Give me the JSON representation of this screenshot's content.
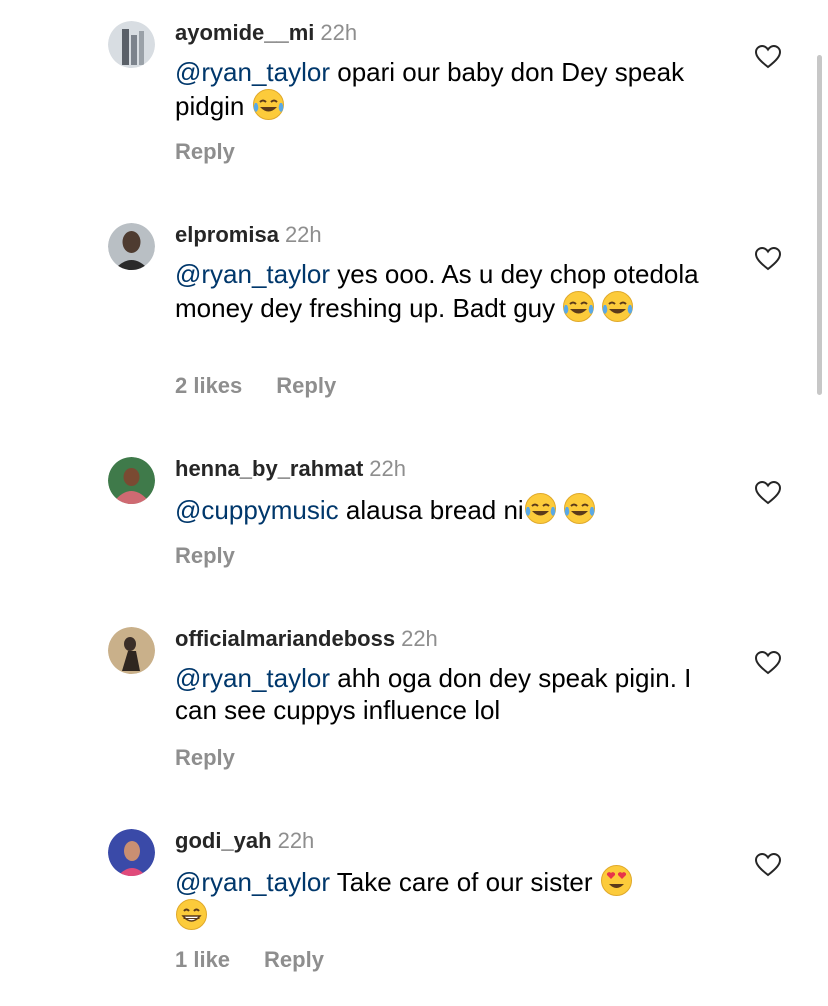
{
  "comments": [
    {
      "username": "ayomide__mi",
      "time": "22h",
      "mention": "@ryan_taylor",
      "text": " opari our baby don Dey speak pidgin ",
      "emojis": [
        "face-with-tears-of-joy"
      ],
      "likes": "",
      "reply_label": "Reply",
      "avatar_colors": [
        "#d8dde2",
        "#5a6068"
      ]
    },
    {
      "username": "elpromisa",
      "time": "22h",
      "mention": "@ryan_taylor",
      "text": " yes ooo. As u dey chop otedola money dey freshing up. Badt guy ",
      "emojis": [
        "face-with-tears-of-joy",
        "face-with-tears-of-joy"
      ],
      "likes": "2 likes",
      "reply_label": "Reply",
      "avatar_colors": [
        "#b9bfc4",
        "#4e3b30"
      ]
    },
    {
      "username": "henna_by_rahmat",
      "time": "22h",
      "mention": "@cuppymusic",
      "text": " alausa bread ni",
      "emojis": [
        "face-with-tears-of-joy",
        "face-with-tears-of-joy"
      ],
      "likes": "",
      "reply_label": "Reply",
      "avatar_colors": [
        "#cf6a72",
        "#3f7a4a"
      ]
    },
    {
      "username": "officialmariandeboss",
      "time": "22h",
      "mention": "@ryan_taylor",
      "text": " ahh oga don dey speak pigin. I can see cuppys influence lol",
      "emojis": [],
      "likes": "",
      "reply_label": "Reply",
      "avatar_colors": [
        "#c9b08a",
        "#3b2f28"
      ]
    },
    {
      "username": "godi_yah",
      "time": "22h",
      "mention": "@ryan_taylor",
      "text": " Take care of our sister ",
      "emojis": [
        "smiling-face-with-heart-eyes",
        "beaming-face"
      ],
      "likes": "1 like",
      "reply_label": "Reply",
      "avatar_colors": [
        "#3a4aa8",
        "#e04a7a"
      ]
    }
  ],
  "colors": {
    "mention": "#00376b",
    "username": "#262626",
    "secondary": "#8e8e8e",
    "emoji_face": "#fccb3b",
    "emoji_tear": "#5aa9e6"
  },
  "icons": {
    "like": "heart-outline-icon"
  }
}
